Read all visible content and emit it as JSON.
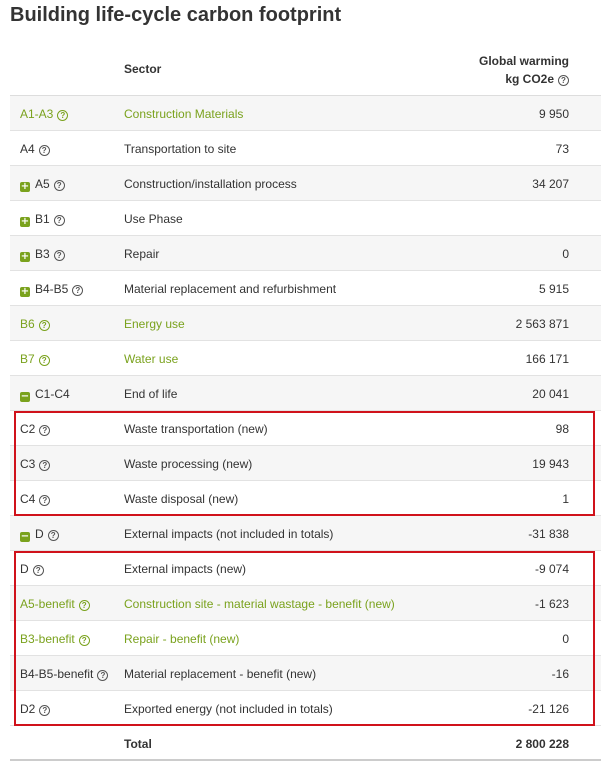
{
  "title": "Building life-cycle carbon footprint",
  "header": {
    "sector": "Sector",
    "gw_line1": "Global warming",
    "gw_line2": "kg CO2e"
  },
  "rows": [
    {
      "code": "A1-A3",
      "sector": "Construction Materials",
      "value": "9 950",
      "green": true,
      "toggle": ""
    },
    {
      "code": "A4",
      "sector": "Transportation to site",
      "value": "73",
      "green": false,
      "toggle": ""
    },
    {
      "code": "A5",
      "sector": "Construction/installation process",
      "value": "34 207",
      "green": false,
      "toggle": "+"
    },
    {
      "code": "B1",
      "sector": "Use Phase",
      "value": "",
      "green": false,
      "toggle": "+"
    },
    {
      "code": "B3",
      "sector": "Repair",
      "value": "0",
      "green": false,
      "toggle": "+"
    },
    {
      "code": "B4-B5",
      "sector": "Material replacement and refurbishment",
      "value": "5 915",
      "green": false,
      "toggle": "+"
    },
    {
      "code": "B6",
      "sector": "Energy use",
      "value": "2 563 871",
      "green": true,
      "toggle": ""
    },
    {
      "code": "B7",
      "sector": "Water use",
      "value": "166 171",
      "green": true,
      "toggle": ""
    },
    {
      "code": "C1-C4",
      "sector": "End of life",
      "value": "20 041",
      "green": false,
      "toggle": "−",
      "nohelp": true
    },
    {
      "code": "C2",
      "sector": "Waste transportation (new)",
      "value": "98",
      "green": false,
      "toggle": ""
    },
    {
      "code": "C3",
      "sector": "Waste processing (new)",
      "value": "19 943",
      "green": false,
      "toggle": ""
    },
    {
      "code": "C4",
      "sector": "Waste disposal (new)",
      "value": "1",
      "green": false,
      "toggle": ""
    },
    {
      "code": "D",
      "sector": "External impacts (not included in totals)",
      "value": "-31 838",
      "green": false,
      "toggle": "−"
    },
    {
      "code": "D",
      "sector": "External impacts (new)",
      "value": "-9 074",
      "green": false,
      "toggle": ""
    },
    {
      "code": "A5-benefit",
      "sector": "Construction site - material wastage - benefit (new)",
      "value": "-1 623",
      "green": true,
      "toggle": ""
    },
    {
      "code": "B3-benefit",
      "sector": "Repair - benefit (new)",
      "value": "0",
      "green": true,
      "toggle": ""
    },
    {
      "code": "B4-B5-benefit",
      "sector": "Material replacement - benefit (new)",
      "value": "-16",
      "green": false,
      "toggle": ""
    },
    {
      "code": "D2",
      "sector": "Exported energy (not included in totals)",
      "value": "-21 126",
      "green": false,
      "toggle": ""
    }
  ],
  "total": {
    "label": "Total",
    "value": "2 800 228"
  },
  "colors": {
    "accent_green": "#7aa21d",
    "highlight_red": "#d0121b",
    "row_shade": "#f6f6f6"
  }
}
